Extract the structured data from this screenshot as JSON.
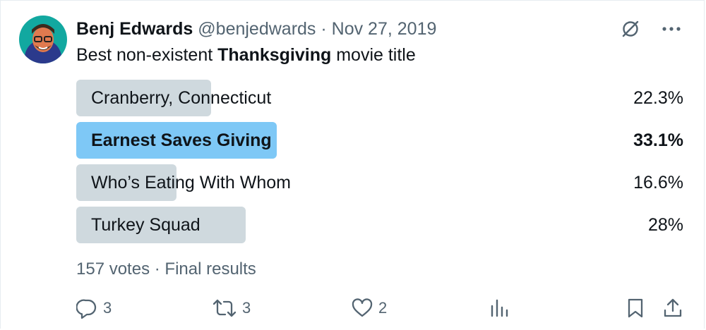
{
  "tweet": {
    "author_name": "Benj Edwards",
    "handle": "@benjedwards",
    "separator": "·",
    "date": "Nov 27, 2019",
    "text_before": "Best non-existent ",
    "text_bold": "Thanksgiving",
    "text_after": " movie title"
  },
  "poll": {
    "options": [
      {
        "label": "Cranberry, Connecticut",
        "percent_text": "22.3%",
        "percent": 22.3,
        "winner": false
      },
      {
        "label": "Earnest Saves Giving",
        "percent_text": "33.1%",
        "percent": 33.1,
        "winner": true
      },
      {
        "label": "Who’s Eating With Whom",
        "percent_text": "16.6%",
        "percent": 16.6,
        "winner": false
      },
      {
        "label": "Turkey Squad",
        "percent_text": "28%",
        "percent": 28,
        "winner": false
      }
    ],
    "votes": "157 votes",
    "separator": "·",
    "status": "Final results"
  },
  "actions": {
    "reply_count": "3",
    "retweet_count": "3",
    "like_count": "2"
  },
  "icons": {
    "top": [
      "grok-icon",
      "more-icon"
    ],
    "bottom": [
      "reply-icon",
      "retweet-icon",
      "like-icon",
      "analytics-icon",
      "bookmark-icon",
      "share-icon"
    ]
  },
  "colors": {
    "text": "#0f1419",
    "secondary": "#536471",
    "bar": "#cfd9de",
    "winner_bar": "#7ec8f6"
  }
}
